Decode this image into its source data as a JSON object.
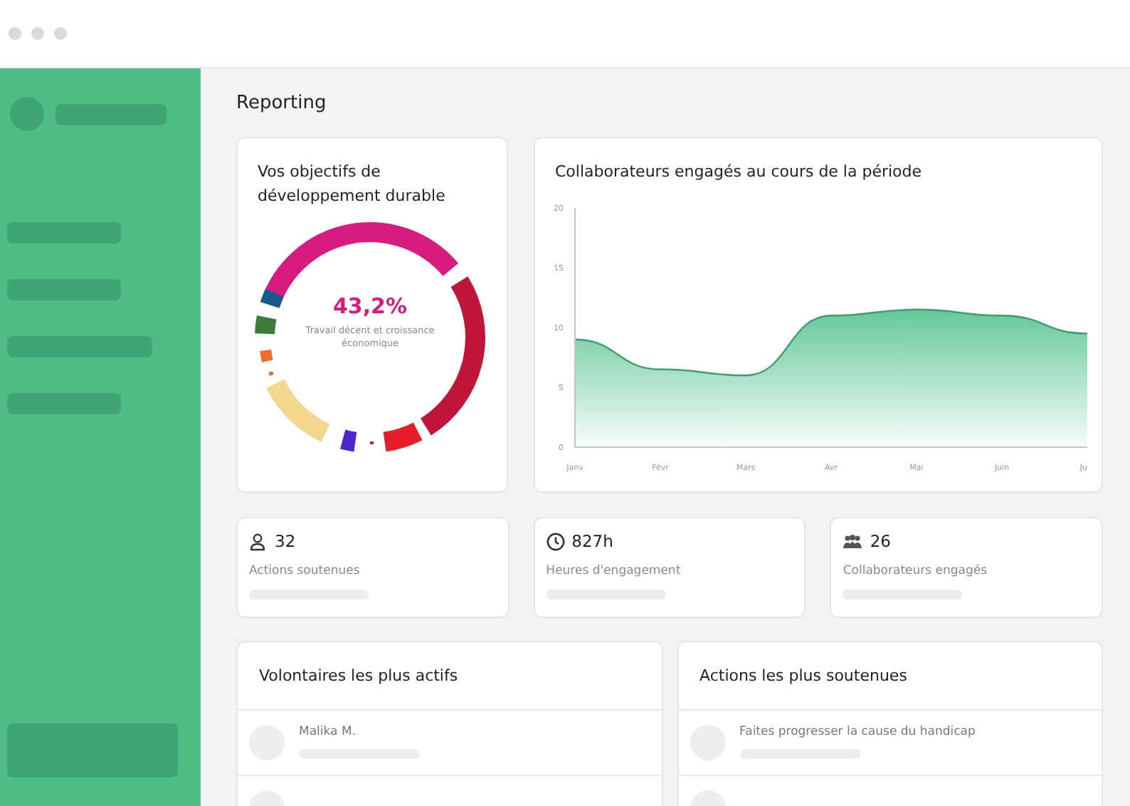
{
  "page": {
    "title": "Reporting"
  },
  "goals_card": {
    "title": "Vos objectifs de développement durable",
    "highlight_value": "43,2%",
    "highlight_label": "Travail décent et croissance économique"
  },
  "engagement_card": {
    "title": "Collaborateurs engagés au cours de la période",
    "chart_data": {
      "type": "area",
      "categories": [
        "Janv",
        "Févr",
        "Mars",
        "Avr",
        "Mai",
        "Juin",
        "Ju"
      ],
      "series": [
        {
          "color": "#5cc595",
          "values": [
            9,
            6.5,
            6,
            11,
            11.5,
            11,
            9.5
          ]
        }
      ],
      "ylim": [
        0,
        20
      ],
      "yticks": [
        0,
        5,
        10,
        15,
        20
      ]
    }
  },
  "stats": [
    {
      "kind": "person",
      "value": "32",
      "label": "Actions soutenues"
    },
    {
      "kind": "clock",
      "value": "827h",
      "label": "Heures d'engagement"
    },
    {
      "kind": "group",
      "value": "26",
      "label": "Collaborateurs engagés"
    }
  ],
  "volunteers": {
    "title": "Volontaires les plus actifs",
    "rows": [
      {
        "name": "Malika M."
      }
    ]
  },
  "actions": {
    "title": "Actions les plus soutenues",
    "rows": [
      {
        "name": "Faites progresser la cause du handicap"
      }
    ]
  }
}
